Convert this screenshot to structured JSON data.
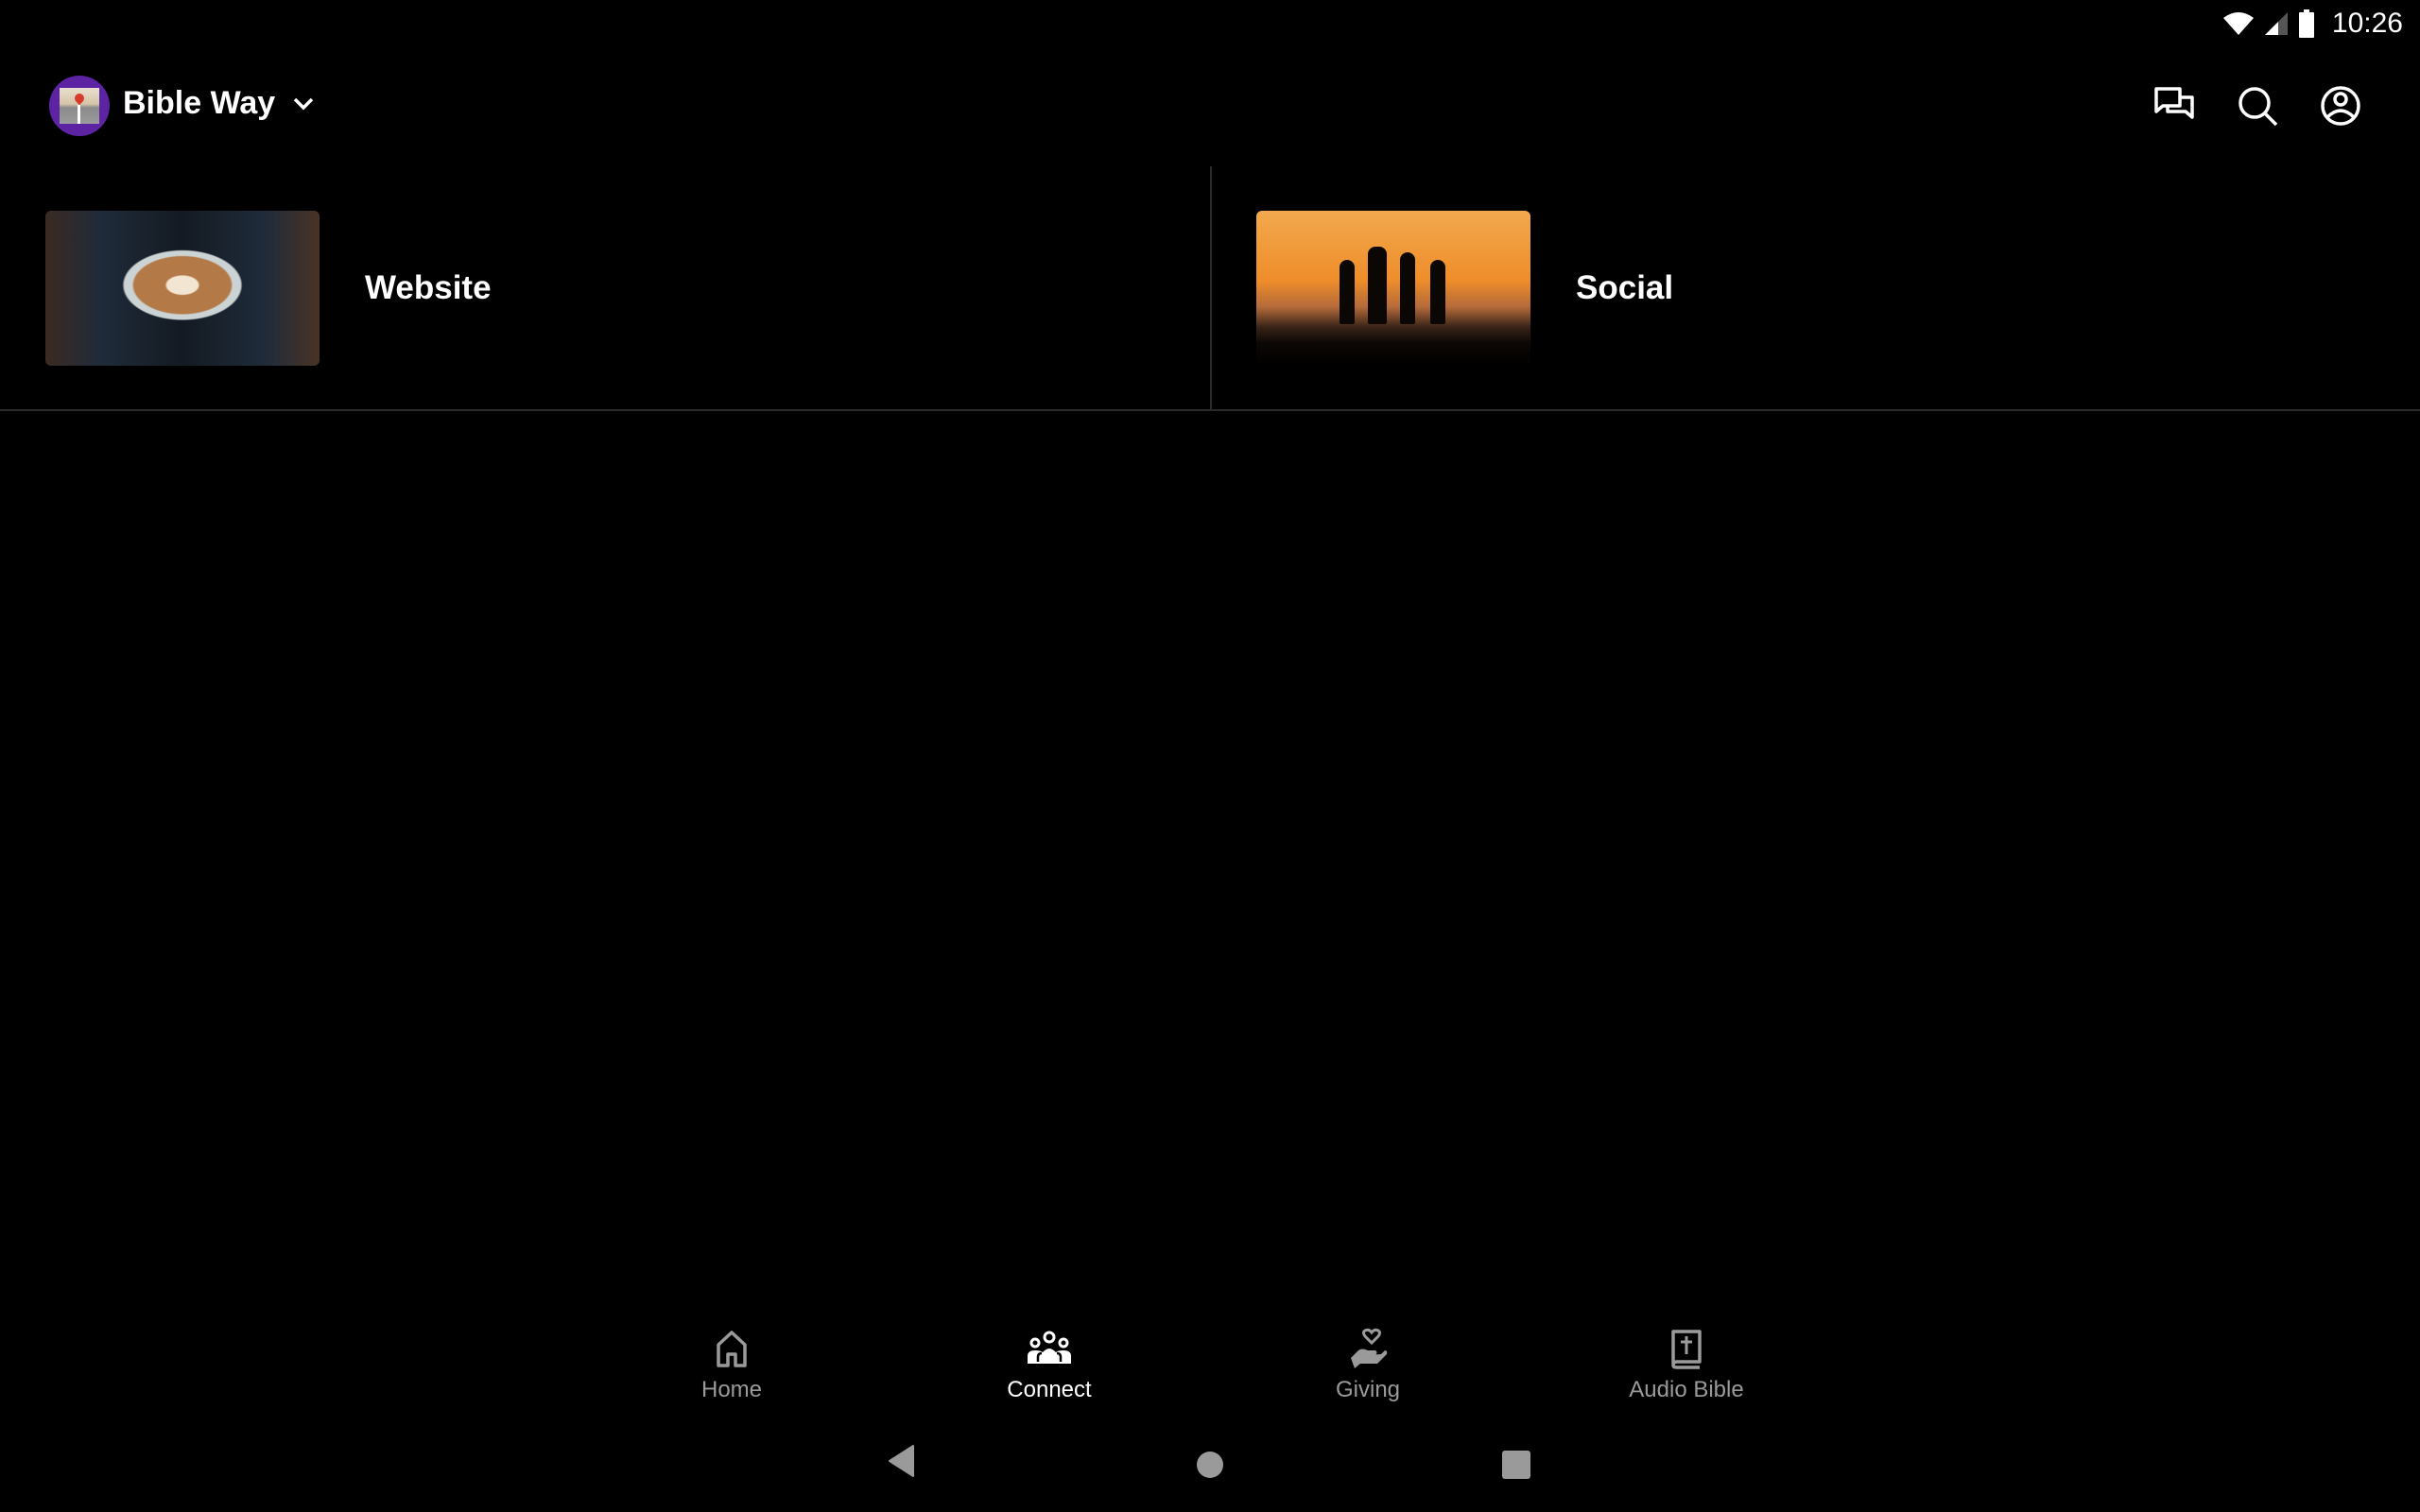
{
  "status_bar": {
    "time": "10:26",
    "icons": [
      "wifi-icon",
      "cellular-signal-icon",
      "battery-icon"
    ]
  },
  "header": {
    "app_title": "Bible Way",
    "logo": "bible-way-logo",
    "dropdown_icon": "chevron-down-icon",
    "actions": [
      {
        "icon": "chat-icon",
        "label": "Messages"
      },
      {
        "icon": "search-icon",
        "label": "Search"
      },
      {
        "icon": "account-icon",
        "label": "Profile"
      }
    ]
  },
  "main": {
    "tiles": [
      {
        "label": "Website",
        "image": "coffee-latte-photo"
      },
      {
        "label": "Social",
        "image": "sunset-silhouettes-photo"
      }
    ]
  },
  "bottom_nav": {
    "active": "Connect",
    "items": [
      {
        "label": "Home",
        "icon": "home-icon"
      },
      {
        "label": "Connect",
        "icon": "people-icon"
      },
      {
        "label": "Giving",
        "icon": "giving-hand-heart-icon"
      },
      {
        "label": "Audio Bible",
        "icon": "bible-icon"
      }
    ]
  },
  "system_nav": {
    "buttons": [
      "back",
      "home",
      "recents"
    ]
  },
  "colors": {
    "background": "#000000",
    "logo_ring": "#5c23a3",
    "inactive_nav": "#9a9a9a",
    "active_nav": "#ffffff",
    "divider": "#2a2a2a"
  }
}
